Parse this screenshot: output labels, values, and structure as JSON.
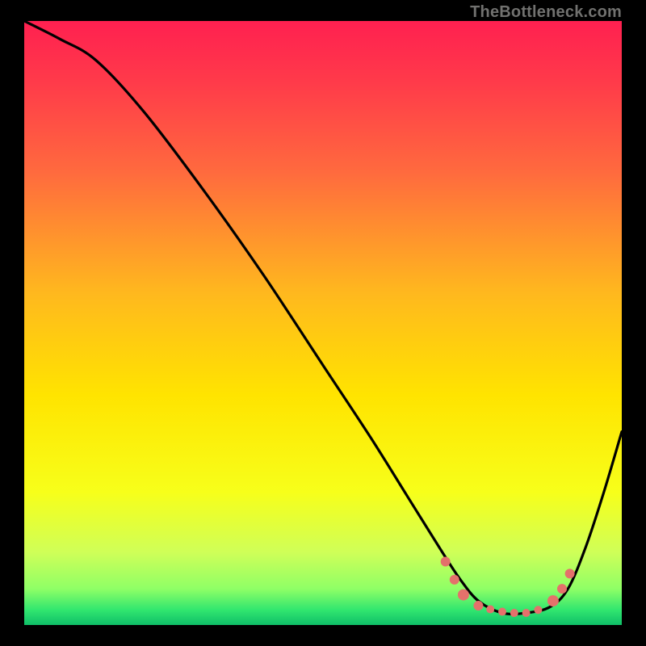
{
  "watermark": "TheBottleneck.com",
  "chart_data": {
    "type": "line",
    "title": "",
    "xlabel": "",
    "ylabel": "",
    "xlim": [
      0,
      100
    ],
    "ylim": [
      0,
      100
    ],
    "gradient_stops": [
      {
        "offset": 0.0,
        "color": "#ff2050"
      },
      {
        "offset": 0.1,
        "color": "#ff3a4a"
      },
      {
        "offset": 0.25,
        "color": "#ff6a3e"
      },
      {
        "offset": 0.45,
        "color": "#ffb81e"
      },
      {
        "offset": 0.62,
        "color": "#ffe400"
      },
      {
        "offset": 0.78,
        "color": "#f7ff1a"
      },
      {
        "offset": 0.88,
        "color": "#cfff58"
      },
      {
        "offset": 0.94,
        "color": "#8fff66"
      },
      {
        "offset": 0.975,
        "color": "#31e66f"
      },
      {
        "offset": 1.0,
        "color": "#0fbf68"
      }
    ],
    "series": [
      {
        "name": "bottleneck-curve",
        "x": [
          0,
          6,
          12,
          20,
          30,
          40,
          50,
          58,
          64,
          70,
          73,
          76,
          80,
          84,
          88,
          91,
          94,
          97,
          100
        ],
        "y": [
          100,
          97,
          93.5,
          85,
          72,
          58,
          43,
          31,
          21.5,
          12,
          7.5,
          4,
          2,
          2,
          3,
          6,
          13,
          22,
          32
        ]
      }
    ],
    "markers": {
      "name": "curve-markers",
      "color": "#e4716b",
      "points": [
        {
          "x": 70.5,
          "y": 10.5,
          "r": 6
        },
        {
          "x": 72.0,
          "y": 7.5,
          "r": 6
        },
        {
          "x": 73.5,
          "y": 5.0,
          "r": 7
        },
        {
          "x": 76.0,
          "y": 3.2,
          "r": 6
        },
        {
          "x": 78.0,
          "y": 2.6,
          "r": 5
        },
        {
          "x": 80.0,
          "y": 2.2,
          "r": 5
        },
        {
          "x": 82.0,
          "y": 2.0,
          "r": 5
        },
        {
          "x": 84.0,
          "y": 2.0,
          "r": 5
        },
        {
          "x": 86.0,
          "y": 2.5,
          "r": 5
        },
        {
          "x": 88.5,
          "y": 4.0,
          "r": 7
        },
        {
          "x": 90.0,
          "y": 6.0,
          "r": 6
        },
        {
          "x": 91.3,
          "y": 8.5,
          "r": 6
        }
      ]
    }
  }
}
